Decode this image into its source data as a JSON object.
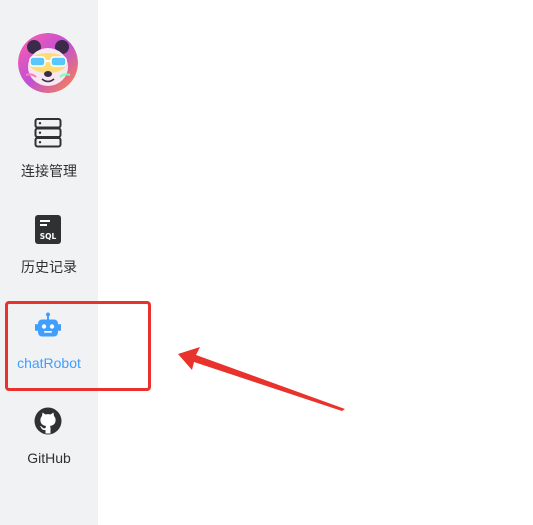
{
  "sidebar": {
    "avatar_icon": "panda-avatar",
    "items": [
      {
        "label": "连接管理",
        "icon": "server-icon",
        "active": false
      },
      {
        "label": "历史记录",
        "icon": "sql-file-icon",
        "active": false
      },
      {
        "label": "chatRobot",
        "icon": "robot-icon",
        "active": true
      },
      {
        "label": "GitHub",
        "icon": "github-icon",
        "active": false
      }
    ]
  },
  "annotation": {
    "highlight_color": "#e8322b"
  },
  "colors": {
    "active": "#409eff",
    "text": "#303133",
    "sidebar_bg": "#f1f2f4"
  }
}
